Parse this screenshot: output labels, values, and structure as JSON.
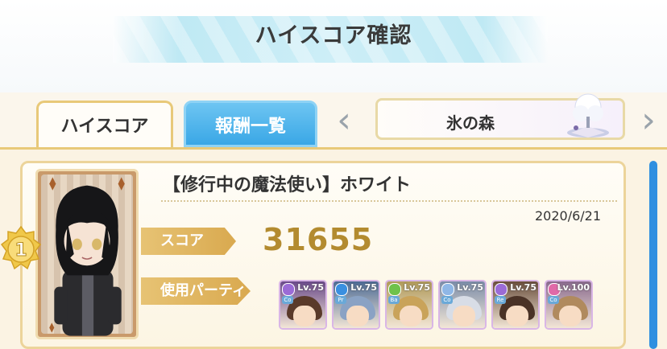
{
  "header": {
    "title": "ハイスコア確認"
  },
  "tabs": [
    {
      "label": "ハイスコア",
      "active": true
    },
    {
      "label": "報酬一覧",
      "active": false
    }
  ],
  "stage": {
    "name": "氷の森",
    "icon": "snow-tree-icon",
    "prev_icon": "chevron-left-icon",
    "next_icon": "chevron-right-icon"
  },
  "entry": {
    "rank": "1",
    "character_name": "【修行中の魔法使い】ホワイト",
    "date": "2020/6/21",
    "score_label": "スコア",
    "score": "31655",
    "party_label": "使用パーティ",
    "party": [
      {
        "level": "Lv.75",
        "attr_color": "#9b6bd6",
        "type": "Co",
        "hair": "#5a3a2a",
        "bg": "#6b4a8a"
      },
      {
        "level": "Lv.75",
        "attr_color": "#3a8fe0",
        "type": "Pr",
        "hair": "#8aa2c4",
        "bg": "#4c6a94"
      },
      {
        "level": "Lv.75",
        "attr_color": "#6fc24a",
        "type": "Ba",
        "hair": "#c9a35a",
        "bg": "#b09a5a"
      },
      {
        "level": "Lv.75",
        "attr_color": "#8fb7e6",
        "type": "Co",
        "hair": "#d8dde6",
        "bg": "#7b8ca8"
      },
      {
        "level": "Lv.75",
        "attr_color": "#9b6bd6",
        "type": "Re",
        "hair": "#4a3226",
        "bg": "#6a4e3c"
      },
      {
        "level": "Lv.100",
        "attr_color": "#e06aa8",
        "type": "Co",
        "hair": "#b08a5e",
        "bg": "#8a6a8e"
      }
    ]
  },
  "colors": {
    "accent_gold": "#e8c979",
    "tab_blue": "#3aa7e6",
    "score_gold": "#b38b2f",
    "scrollbar": "#2f8fe0"
  }
}
